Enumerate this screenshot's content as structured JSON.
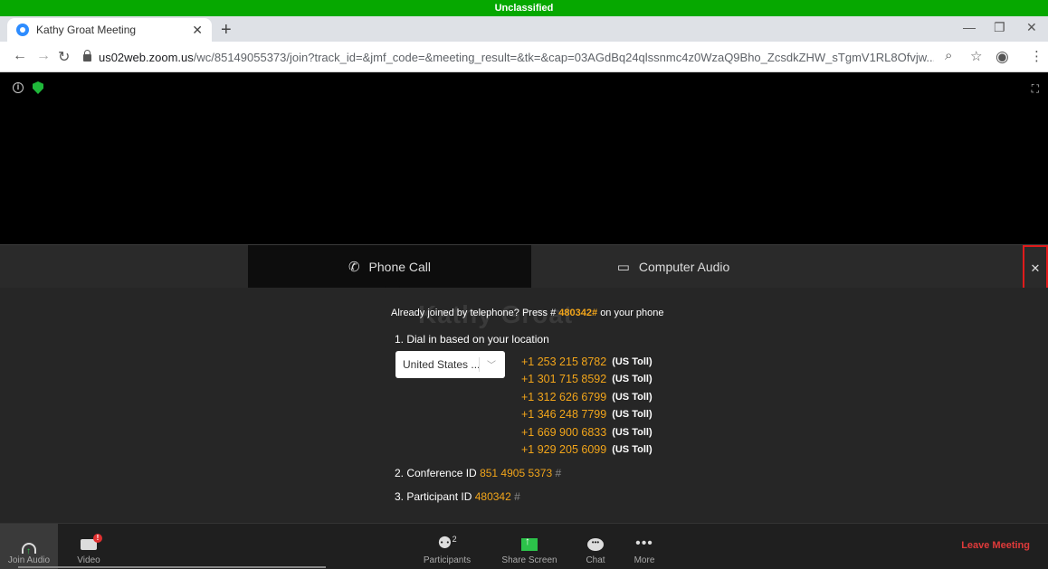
{
  "classification": "Unclassified",
  "browser": {
    "tab_title": "Kathy Groat Meeting",
    "url_host": "us02web.zoom.us",
    "url_path": "/wc/85149055373/join?track_id=&jmf_code=&meeting_result=&tk=&cap=03AGdBq24qlssnmc4z0WzaQ9Bho_ZcsdkZHW_sTgmV1RL8Ofvjw..."
  },
  "audio_tabs": {
    "phone": "Phone Call",
    "computer": "Computer Audio"
  },
  "watermark_name": "Kathy Groat",
  "phone_panel": {
    "already_prefix": "Already joined by telephone? Press #",
    "participant_code": "480342#",
    "already_suffix": "on your phone",
    "step1": "1. Dial in based on your location",
    "country_selected": "United States ...",
    "numbers": [
      {
        "number": "+1 253 215 8782",
        "label": "(US Toll)"
      },
      {
        "number": "+1 301 715 8592",
        "label": "(US Toll)"
      },
      {
        "number": "+1 312 626 6799",
        "label": "(US Toll)"
      },
      {
        "number": "+1 346 248 7799",
        "label": "(US Toll)"
      },
      {
        "number": "+1 669 900 6833",
        "label": "(US Toll)"
      },
      {
        "number": "+1 929 205 6099",
        "label": "(US Toll)"
      }
    ],
    "step2_label": "2. Conference ID",
    "conference_id": "851 4905 5373",
    "step3_label": "3. Participant ID",
    "participant_id": "480342",
    "hash": "#"
  },
  "toolbar": {
    "join_audio": "Join Audio",
    "video": "Video",
    "participants": "Participants",
    "participant_count": "2",
    "share_screen": "Share Screen",
    "chat": "Chat",
    "more": "More",
    "leave": "Leave Meeting"
  },
  "colors": {
    "accent": "#f2a51a",
    "leave": "#e03a3a",
    "classbar": "#06a800",
    "close_highlight": "#e01b1b"
  }
}
